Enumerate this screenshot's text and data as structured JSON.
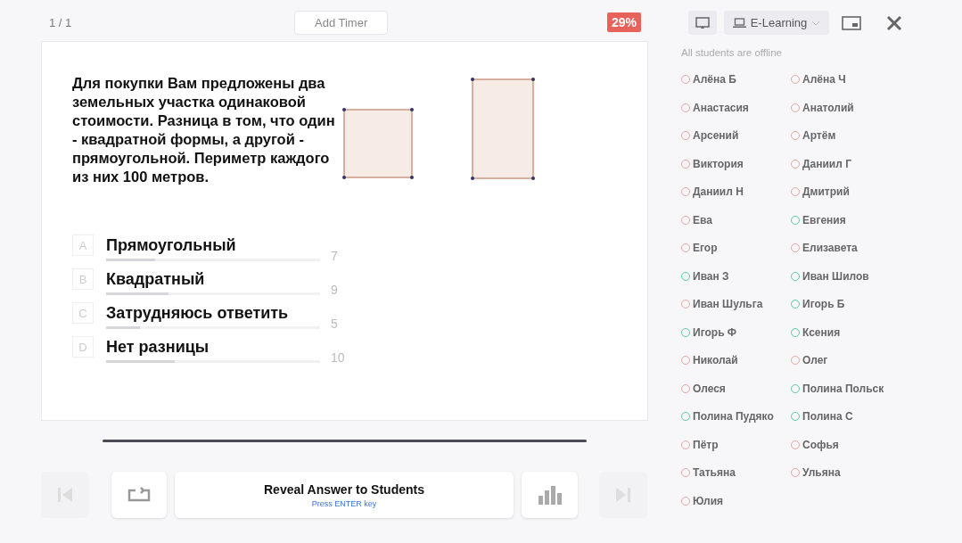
{
  "top_bar": {
    "slide_counter": "1 / 1",
    "timer_button": "Add Timer",
    "score_badge": "29%"
  },
  "question": {
    "text": "Для покупки Вам предложены два земельных участка одинаковой стоимости. Разница в том, что один - квадратной формы, а другой - прямоугольной. Периметр каждого из них 100 метров."
  },
  "answers": [
    {
      "letter": "A",
      "text": "Прямоугольный",
      "level": 0.23,
      "count": "7"
    },
    {
      "letter": "B",
      "text": "Квадратный",
      "level": 0.29,
      "count": "9"
    },
    {
      "letter": "C",
      "text": "Затрудняюсь ответить",
      "level": 0.16,
      "count": "5"
    },
    {
      "letter": "D",
      "text": "Нет разницы",
      "level": 0.32,
      "count": "10"
    }
  ],
  "controls": {
    "previous_disabled": true,
    "next_disabled": true,
    "reveal_button": {
      "label": "Reveal Answer to Students",
      "hint": "Press ENTER key"
    }
  },
  "panel": {
    "class_selector": "E-Learning",
    "status": "All students are offline",
    "students": [
      {
        "name": "Алёна Б",
        "online": false
      },
      {
        "name": "Алёна Ч",
        "online": false
      },
      {
        "name": "Анастасия",
        "online": false
      },
      {
        "name": "Анатолий",
        "online": false
      },
      {
        "name": "Арсений",
        "online": false
      },
      {
        "name": "Артём",
        "online": false
      },
      {
        "name": "Виктория",
        "online": false
      },
      {
        "name": "Даниил Г",
        "online": false
      },
      {
        "name": "Даниил Н",
        "online": false
      },
      {
        "name": "Дмитрий",
        "online": false
      },
      {
        "name": "Ева",
        "online": false
      },
      {
        "name": "Евгения",
        "online": true
      },
      {
        "name": "Егор",
        "online": false
      },
      {
        "name": "Елизавета",
        "online": false
      },
      {
        "name": "Иван З",
        "online": true
      },
      {
        "name": "Иван Шилов",
        "online": true
      },
      {
        "name": "Иван Шульга",
        "online": false
      },
      {
        "name": "Игорь Б",
        "online": true
      },
      {
        "name": "Игорь Ф",
        "online": true
      },
      {
        "name": "Ксения",
        "online": true
      },
      {
        "name": "Николай",
        "online": false
      },
      {
        "name": "Олег",
        "online": false
      },
      {
        "name": "Олеся",
        "online": false
      },
      {
        "name": "Полина Польск",
        "online": true
      },
      {
        "name": "Полина Пудяко",
        "online": true
      },
      {
        "name": "Полина С",
        "online": true
      },
      {
        "name": "Пётр",
        "online": false
      },
      {
        "name": "Софья",
        "online": false
      },
      {
        "name": "Татьяна",
        "online": false
      },
      {
        "name": "Ульяна",
        "online": false
      },
      {
        "name": "Юлия",
        "online": false
      }
    ]
  }
}
